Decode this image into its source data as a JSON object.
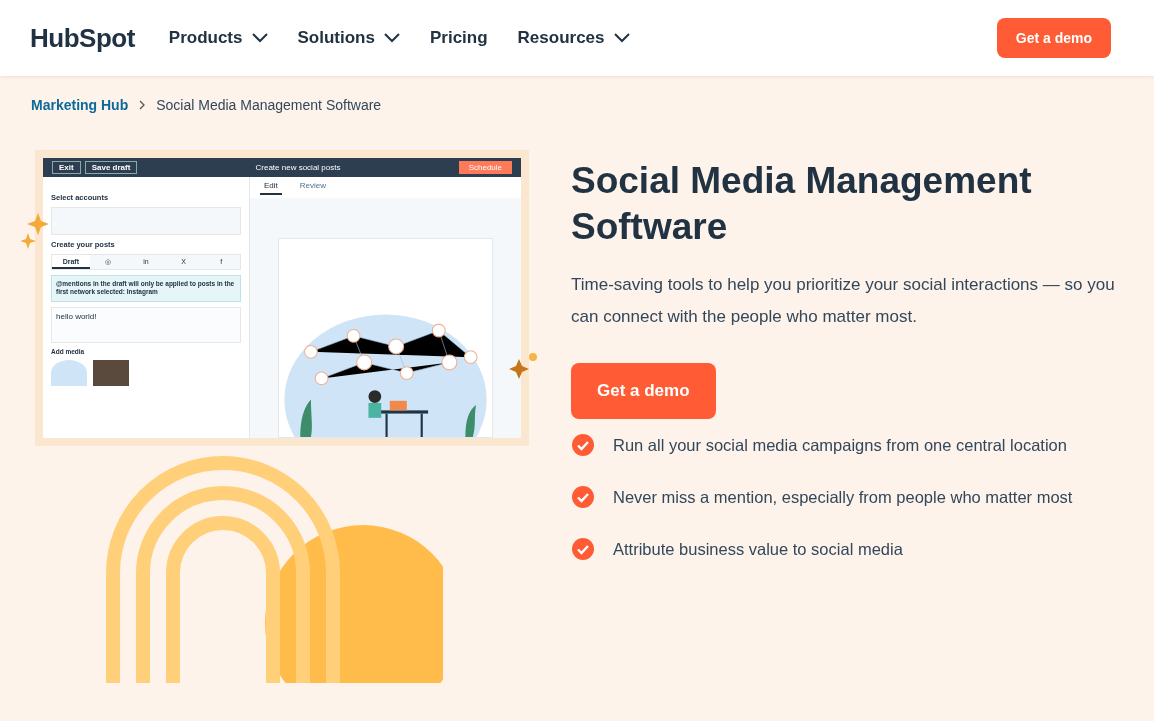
{
  "header": {
    "logo": "HubSpot",
    "nav": [
      {
        "label": "Products",
        "dropdown": true
      },
      {
        "label": "Solutions",
        "dropdown": true
      },
      {
        "label": "Pricing",
        "dropdown": false
      },
      {
        "label": "Resources",
        "dropdown": true
      }
    ],
    "cta": "Get a demo"
  },
  "breadcrumb": [
    {
      "label": "Marketing Hub",
      "link": true
    },
    {
      "label": "Social Media Management Software",
      "link": false
    }
  ],
  "mockup": {
    "top_buttons": [
      "Exit",
      "Save draft"
    ],
    "title": "Create new social posts",
    "schedule": "Schedule",
    "tabs": [
      {
        "label": "Edit",
        "selected": true
      },
      {
        "label": "Review",
        "selected": false
      }
    ],
    "select_accounts": "Select accounts",
    "create_posts": "Create your posts",
    "post_tabs": [
      {
        "label": "Draft",
        "selected": true
      },
      {
        "label": "◎",
        "selected": false
      },
      {
        "label": "in",
        "selected": false
      },
      {
        "label": "X",
        "selected": false
      },
      {
        "label": "f",
        "selected": false
      }
    ],
    "notice": "@mentions in the draft will only be applied to posts in the first network selected: Instagram",
    "draft_text": "hello world!",
    "add_media": "Add media"
  },
  "hero": {
    "title": "Social Media Management Software",
    "description": "Time-saving tools to help you prioritize your social interactions — so you can connect with the people who matter most.",
    "cta": "Get a demo",
    "features": [
      "Run all your social media campaigns from one central location",
      "Never miss a mention, especially from people who matter most",
      "Attribute business value to social media"
    ]
  }
}
